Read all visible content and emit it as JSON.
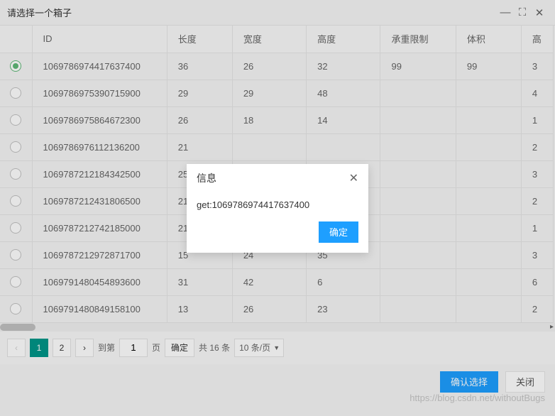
{
  "window": {
    "title": "请选择一个箱子"
  },
  "columns": {
    "id": "ID",
    "length": "长度",
    "width": "宽度",
    "height": "高度",
    "limit": "承重限制",
    "volume": "体积",
    "last": "高"
  },
  "rows": [
    {
      "id": "1069786974417637400",
      "length": "36",
      "width": "26",
      "height": "32",
      "limit": "99",
      "volume": "99",
      "last": "3"
    },
    {
      "id": "1069786975390715900",
      "length": "29",
      "width": "29",
      "height": "48",
      "limit": "",
      "volume": "",
      "last": "4"
    },
    {
      "id": "1069786975864672300",
      "length": "26",
      "width": "18",
      "height": "14",
      "limit": "",
      "volume": "",
      "last": "1"
    },
    {
      "id": "1069786976112136200",
      "length": "21",
      "width": "",
      "height": "",
      "limit": "",
      "volume": "",
      "last": "2"
    },
    {
      "id": "1069787212184342500",
      "length": "25",
      "width": "",
      "height": "",
      "limit": "",
      "volume": "",
      "last": "3"
    },
    {
      "id": "1069787212431806500",
      "length": "21",
      "width": "",
      "height": "",
      "limit": "",
      "volume": "",
      "last": "2"
    },
    {
      "id": "1069787212742185000",
      "length": "21",
      "width": "",
      "height": "",
      "limit": "",
      "volume": "",
      "last": "1"
    },
    {
      "id": "1069787212972871700",
      "length": "15",
      "width": "24",
      "height": "35",
      "limit": "",
      "volume": "",
      "last": "3"
    },
    {
      "id": "1069791480454893600",
      "length": "31",
      "width": "42",
      "height": "6",
      "limit": "",
      "volume": "",
      "last": "6"
    },
    {
      "id": "1069791480849158100",
      "length": "13",
      "width": "26",
      "height": "23",
      "limit": "",
      "volume": "",
      "last": "2"
    }
  ],
  "selectedIndex": 0,
  "pagination": {
    "prev": "‹",
    "next": "›",
    "pages": [
      "1",
      "2"
    ],
    "active": "1",
    "goto_prefix": "到第",
    "goto_value": "1",
    "goto_suffix": "页",
    "confirm": "确定",
    "total": "共 16 条",
    "per_page": "10 条/页"
  },
  "footer": {
    "confirm": "确认选择",
    "close": "关闭"
  },
  "dialog": {
    "title": "信息",
    "message": "get:1069786974417637400",
    "ok": "确定"
  },
  "watermark": "https://blog.csdn.net/withoutBugs"
}
